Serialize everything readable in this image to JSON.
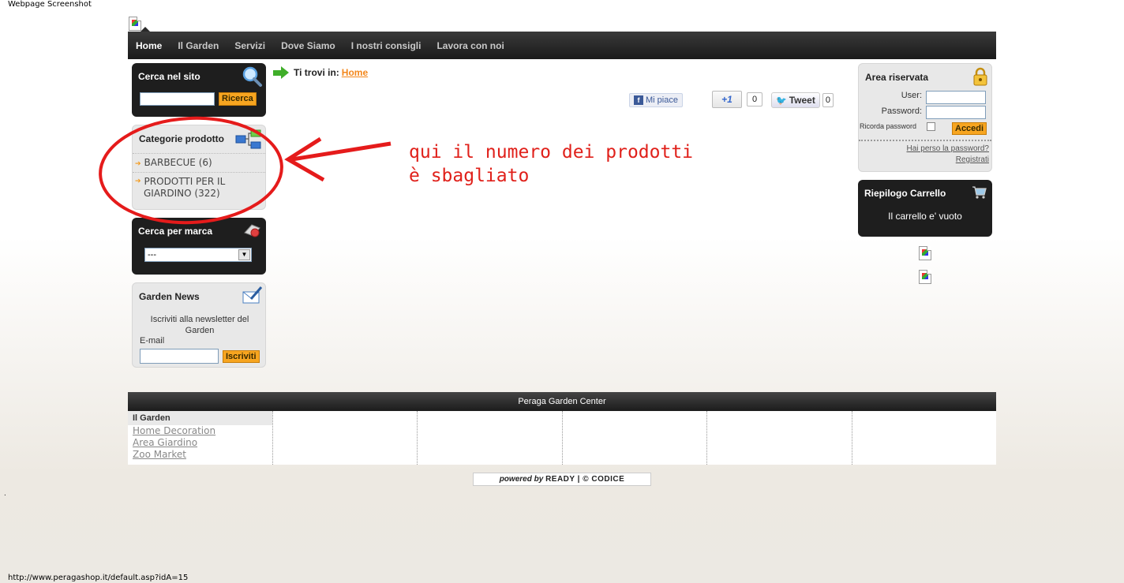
{
  "window": {
    "caption": "Webpage Screenshot",
    "status_url": "http://www.peragashop.it/default.asp?idA=15"
  },
  "nav": {
    "items": [
      {
        "label": "Home",
        "active": true
      },
      {
        "label": "Il Garden"
      },
      {
        "label": "Servizi"
      },
      {
        "label": "Dove Siamo"
      },
      {
        "label": "I nostri consigli"
      },
      {
        "label": "Lavora con noi"
      }
    ]
  },
  "search": {
    "title": "Cerca nel sito",
    "button": "Ricerca",
    "value": ""
  },
  "categories": {
    "title": "Categorie prodotto",
    "items": [
      {
        "label": "BARBECUE (6)"
      },
      {
        "label": "PRODOTTI PER IL GIARDINO (322)"
      }
    ]
  },
  "brand": {
    "title": "Cerca per marca",
    "selected": "---"
  },
  "news": {
    "title": "Garden News",
    "text": "Iscriviti alla newsletter del Garden",
    "email_label": "E-mail",
    "button": "Iscriviti"
  },
  "breadcrumb": {
    "prefix": "Ti trovi in:",
    "current": "Home"
  },
  "social": {
    "fb_label": "Mi piace",
    "gplus_label": "+1",
    "gplus_count": "0",
    "tweet_label": "Tweet",
    "tweet_count": "0"
  },
  "annotation": {
    "text": "qui il numero dei prodotti\nè sbagliato",
    "color": "#e0201a"
  },
  "reserved": {
    "title": "Area riservata",
    "user_label": "User:",
    "password_label": "Password:",
    "remember_label": "Ricorda password",
    "login_button": "Accedi",
    "lost_password": "Hai perso la password?",
    "register": "Registrati"
  },
  "cart": {
    "title": "Riepilogo Carrello",
    "empty_text": "Il carrello e' vuoto"
  },
  "footer": {
    "title": "Peraga Garden Center",
    "columns": [
      {
        "head": "Il Garden",
        "links": [
          "Home Decoration",
          "Area Giardino",
          "Zoo Market"
        ]
      },
      {
        "head": "",
        "links": []
      },
      {
        "head": "",
        "links": []
      },
      {
        "head": "",
        "links": []
      },
      {
        "head": "",
        "links": []
      },
      {
        "head": "",
        "links": []
      }
    ],
    "powered_prefix": "powered by",
    "powered_brands": "READY | © CODICE"
  }
}
